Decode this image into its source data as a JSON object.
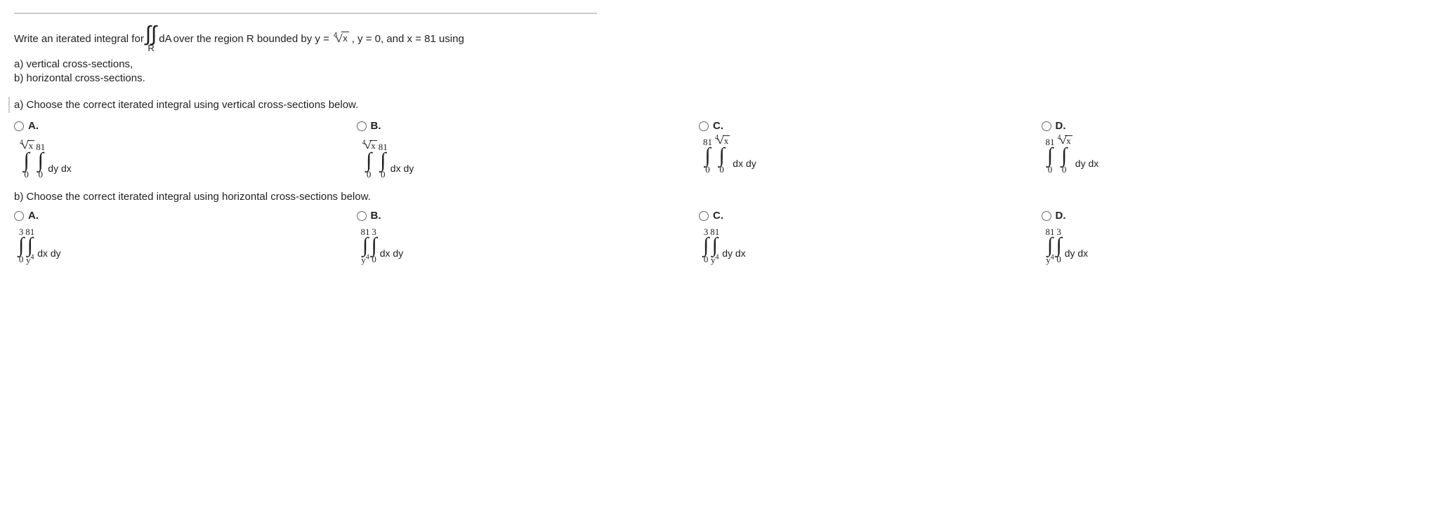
{
  "stem": {
    "pre": "Write an iterated integral for",
    "int_da": "dA",
    "int_sub": "R",
    "post": "over the region R bounded by y =",
    "rad_index": "4",
    "rad_arg": "x",
    "tail": ", y = 0, and x = 81 using",
    "part_a": "a) vertical cross-sections,",
    "part_b": "b) horizontal cross-sections."
  },
  "section_a": "a) Choose the correct iterated integral using vertical cross-sections below.",
  "section_b": "b) Choose the correct iterated integral using horizontal cross-sections below.",
  "row_a": [
    {
      "letter": "A.",
      "outer_up_type": "rad",
      "outer_up_idx": "4",
      "outer_up_arg": "x",
      "outer_lo": "0",
      "inner_up": "81",
      "inner_lo": "0",
      "integrand": "dy dx"
    },
    {
      "letter": "B.",
      "outer_up_type": "rad",
      "outer_up_idx": "4",
      "outer_up_arg": "x",
      "outer_lo": "0",
      "inner_up": "81",
      "inner_lo": "0",
      "integrand": "dx dy"
    },
    {
      "letter": "C.",
      "outer_up": "81",
      "outer_lo": "0",
      "inner_up_type": "rad",
      "inner_up_idx": "4",
      "inner_up_arg": "x",
      "inner_lo": "0",
      "integrand": "dx dy"
    },
    {
      "letter": "D.",
      "outer_up": "81",
      "outer_lo": "0",
      "inner_up_type": "rad",
      "inner_up_idx": "4",
      "inner_up_arg": "x",
      "inner_lo": "0",
      "integrand": "dy dx"
    }
  ],
  "row_b": [
    {
      "letter": "A.",
      "outer_up": "3",
      "outer_lo": "0",
      "inner_up": "81",
      "inner_lo_type": "pow",
      "inner_lo_base": "y",
      "inner_lo_exp": "4",
      "integrand": "dx dy"
    },
    {
      "letter": "B.",
      "outer_up": "81",
      "outer_lo_type": "pow",
      "outer_lo_base": "y",
      "outer_lo_exp": "4",
      "inner_up": "3",
      "inner_lo": "0",
      "integrand": "dx dy"
    },
    {
      "letter": "C.",
      "outer_up": "3",
      "outer_lo": "0",
      "inner_up": "81",
      "inner_lo_type": "pow",
      "inner_lo_base": "y",
      "inner_lo_exp": "4",
      "integrand": "dy dx"
    },
    {
      "letter": "D.",
      "outer_up": "81",
      "outer_lo_type": "pow",
      "outer_lo_base": "y",
      "outer_lo_exp": "4",
      "inner_up": "3",
      "inner_lo": "0",
      "integrand": "dy dx"
    }
  ]
}
